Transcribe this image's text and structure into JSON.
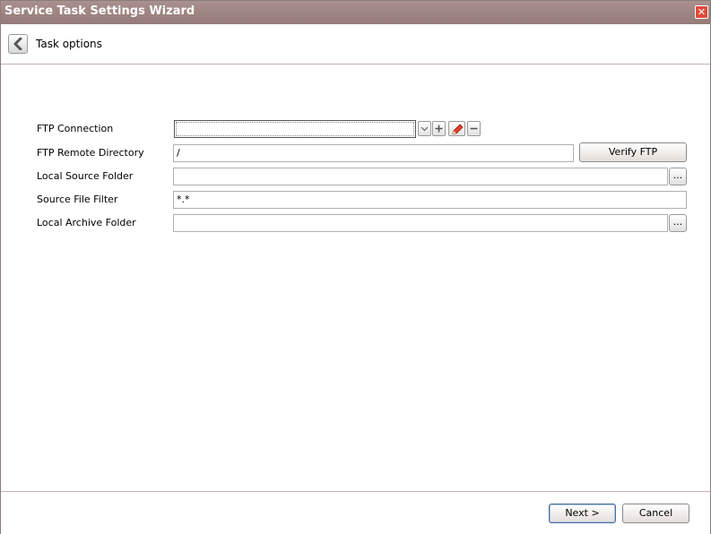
{
  "window": {
    "title": "Service Task Settings Wizard",
    "close_glyph": "✕"
  },
  "header": {
    "title": "Task options"
  },
  "form": {
    "ftp_connection": {
      "label": "FTP Connection",
      "value": ""
    },
    "ftp_remote_directory": {
      "label": "FTP Remote Directory",
      "value": "/"
    },
    "verify_ftp_label": "Verify FTP",
    "local_source_folder": {
      "label": "Local Source Folder",
      "value": "",
      "browse_label": "..."
    },
    "source_file_filter": {
      "label": "Source File Filter",
      "value": "*.*"
    },
    "local_archive_folder": {
      "label": "Local Archive Folder",
      "value": "",
      "browse_label": "..."
    }
  },
  "footer": {
    "next_label": "Next >",
    "cancel_label": "Cancel"
  },
  "icons": {
    "back": "chevron-left-icon",
    "dropdown": "chevron-down-icon",
    "add": "plus-icon",
    "edit": "pencil-icon",
    "remove": "minus-icon"
  }
}
